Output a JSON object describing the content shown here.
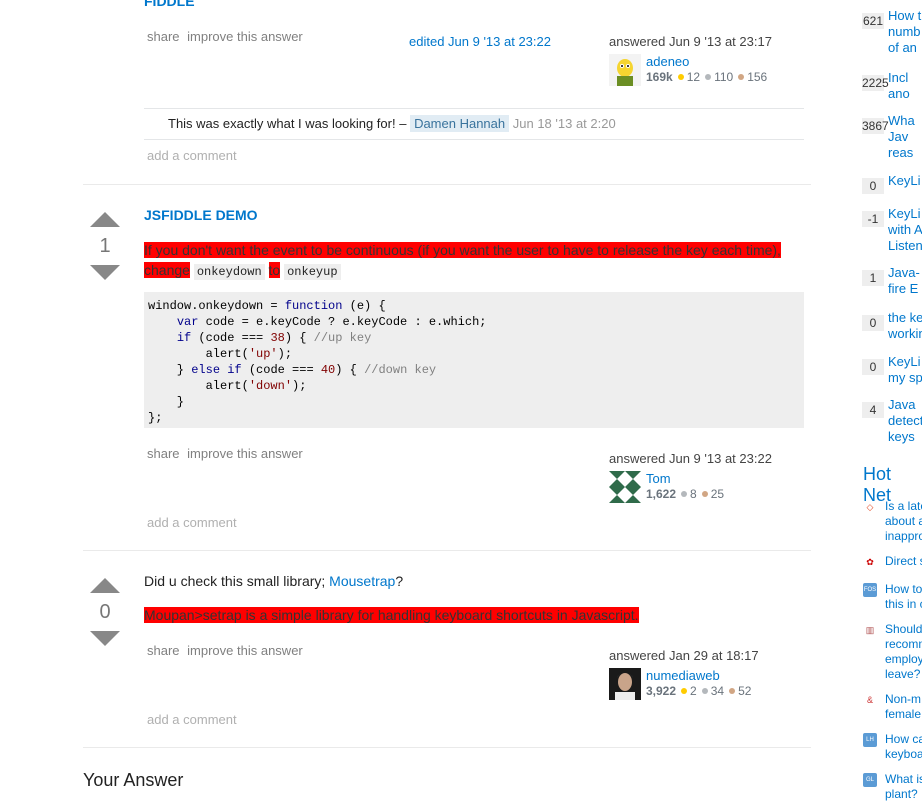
{
  "answer1": {
    "heading_fragment": "FIDDLE",
    "menu": {
      "share": "share",
      "improve": "improve this answer"
    },
    "edited": "edited Jun 9 '13 at 23:22",
    "user": {
      "action": "answered Jun 9 '13 at 23:17",
      "name": "adeneo",
      "rep": "169k",
      "gold": "12",
      "silver": "110",
      "bronze": "156"
    },
    "comment": {
      "text": "This was exactly what I was looking for! –",
      "user": "Damen Hannah",
      "date": "Jun 18 '13 at 2:20"
    },
    "add_comment": "add a comment"
  },
  "answer2": {
    "votes": "1",
    "heading": "JSFIDDLE DEMO",
    "text_part1": "If you don't want the event to be continuous (if you want the user to have to release the key each time), change",
    "code1": "onkeydown",
    "text_to": "to",
    "code2": "onkeyup",
    "code_lines": [
      "window.onkeydown = function (e) {",
      "    var code = e.keyCode ? e.keyCode : e.which;",
      "    if (code === 38) { //up key",
      "        alert('up');",
      "    } else if (code === 40) { //down key",
      "        alert('down');",
      "    }",
      "};"
    ],
    "menu": {
      "share": "share",
      "improve": "improve this answer"
    },
    "user": {
      "action": "answered Jun 9 '13 at 23:22",
      "name": "Tom",
      "rep": "1,622",
      "silver": "8",
      "bronze": "25"
    },
    "add_comment": "add a comment"
  },
  "answer3": {
    "votes": "0",
    "text_prefix": "Did u check this small library;",
    "link": "Mousetrap",
    "text_suffix": "?",
    "highlight": "Moupan>setrap is a simple library for handling keyboard shortcuts in Javascript.",
    "menu": {
      "share": "share",
      "improve": "improve this answer"
    },
    "user": {
      "action": "answered Jan 29 at 18:17",
      "name": "numediaweb",
      "rep": "3,922",
      "gold": "2",
      "silver": "34",
      "bronze": "52"
    },
    "add_comment": "add a comment"
  },
  "your_answer": "Your Answer",
  "sidebar": {
    "related": [
      {
        "count": "621",
        "lines": [
          "How t",
          "numb",
          "of an"
        ]
      },
      {
        "count": "2225",
        "lines": [
          "Incl",
          "ano"
        ]
      },
      {
        "count": "3867",
        "lines": [
          "Wha",
          "Jav",
          "reas"
        ]
      },
      {
        "count": "0",
        "lines": [
          "KeyLi"
        ]
      },
      {
        "count": "-1",
        "lines": [
          "KeyLi",
          "with A",
          "Listen"
        ]
      },
      {
        "count": "1",
        "lines": [
          "Java-",
          "fire E"
        ]
      },
      {
        "count": "0",
        "lines": [
          "the ke",
          "workin"
        ]
      },
      {
        "count": "0",
        "lines": [
          "KeyLi",
          "my sp"
        ]
      },
      {
        "count": "4",
        "lines": [
          "Java",
          "detect",
          "keys"
        ]
      }
    ],
    "hot_title": "Hot Net",
    "hot": [
      {
        "icon": "◇",
        "color": "#e34c26",
        "lines": [
          "Is a late",
          "about a",
          "inappro"
        ]
      },
      {
        "icon": "✿",
        "color": "#cc0000",
        "lines": [
          "Direct s"
        ]
      },
      {
        "icon": "FOS",
        "color": "#5b9bd5",
        "lines": [
          "How to",
          "this in c"
        ]
      },
      {
        "icon": "▥",
        "color": "#b05050",
        "lines": [
          "Should",
          "recomm",
          "employ",
          "leave?"
        ]
      },
      {
        "icon": "&",
        "color": "#cc3333",
        "lines": [
          "Non-m",
          "female"
        ]
      },
      {
        "icon": "LH",
        "color": "#5b9bd5",
        "lines": [
          "How ca",
          "keyboa"
        ]
      },
      {
        "icon": "GL",
        "color": "#5b9bd5",
        "lines": [
          "What is",
          "plant?"
        ]
      }
    ]
  }
}
